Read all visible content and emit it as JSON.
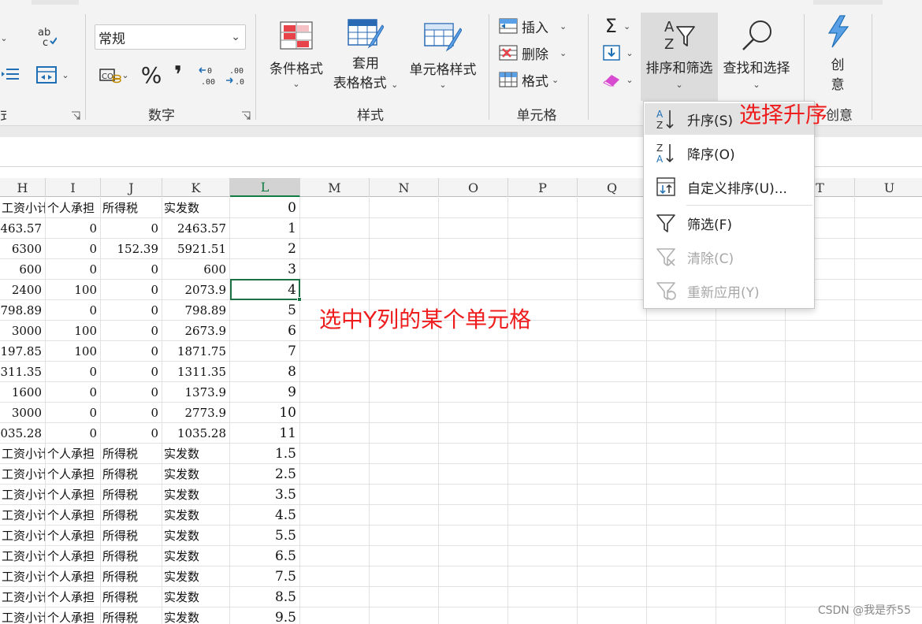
{
  "ribbon": {
    "number_format_value": "常规",
    "groups": {
      "number": "数字",
      "styles": "样式",
      "cells": "单元格",
      "creative": "创意"
    },
    "group_partial_left": "式",
    "percent_symbol": "%",
    "comma_symbol": "❜",
    "buttons": {
      "conditional_format": "条件格式",
      "table_format_line1": "套用",
      "table_format_line2": "表格格式",
      "cell_styles": "单元格样式",
      "insert": "插入",
      "delete": "删除",
      "format": "格式",
      "sort_filter": "排序和筛选",
      "find_select": "查找和选择",
      "creative_line1": "创",
      "creative_line2": "意"
    }
  },
  "grid": {
    "columns": [
      "H",
      "I",
      "J",
      "K",
      "L",
      "M",
      "N",
      "O",
      "P",
      "Q",
      "R",
      "S",
      "T",
      "U"
    ],
    "active_column": "L",
    "visible_dropdown_covered_columns": [
      "T",
      "U"
    ],
    "rows": [
      {
        "h": "工资小计",
        "i": "个人承担",
        "j": "所得税",
        "k": "实发数",
        "l": "0"
      },
      {
        "h": "463.57",
        "i": "0",
        "j": "0",
        "k": "2463.57",
        "l": "1"
      },
      {
        "h": "6300",
        "i": "0",
        "j": "152.39",
        "k": "5921.51",
        "l": "2"
      },
      {
        "h": "600",
        "i": "0",
        "j": "0",
        "k": "600",
        "l": "3"
      },
      {
        "h": "2400",
        "i": "100",
        "j": "0",
        "k": "2073.9",
        "l": "4"
      },
      {
        "h": "798.89",
        "i": "0",
        "j": "0",
        "k": "798.89",
        "l": "5"
      },
      {
        "h": "3000",
        "i": "100",
        "j": "0",
        "k": "2673.9",
        "l": "6"
      },
      {
        "h": "197.85",
        "i": "100",
        "j": "0",
        "k": "1871.75",
        "l": "7"
      },
      {
        "h": "311.35",
        "i": "0",
        "j": "0",
        "k": "1311.35",
        "l": "8"
      },
      {
        "h": "1600",
        "i": "0",
        "j": "0",
        "k": "1373.9",
        "l": "9"
      },
      {
        "h": "3000",
        "i": "0",
        "j": "0",
        "k": "2773.9",
        "l": "10"
      },
      {
        "h": "035.28",
        "i": "0",
        "j": "0",
        "k": "1035.28",
        "l": "11"
      },
      {
        "h": "工资小计",
        "i": "个人承担",
        "j": "所得税",
        "k": "实发数",
        "l": "1.5"
      },
      {
        "h": "工资小计",
        "i": "个人承担",
        "j": "所得税",
        "k": "实发数",
        "l": "2.5"
      },
      {
        "h": "工资小计",
        "i": "个人承担",
        "j": "所得税",
        "k": "实发数",
        "l": "3.5"
      },
      {
        "h": "工资小计",
        "i": "个人承担",
        "j": "所得税",
        "k": "实发数",
        "l": "4.5"
      },
      {
        "h": "工资小计",
        "i": "个人承担",
        "j": "所得税",
        "k": "实发数",
        "l": "5.5"
      },
      {
        "h": "工资小计",
        "i": "个人承担",
        "j": "所得税",
        "k": "实发数",
        "l": "6.5"
      },
      {
        "h": "工资小计",
        "i": "个人承担",
        "j": "所得税",
        "k": "实发数",
        "l": "7.5"
      },
      {
        "h": "工资小计",
        "i": "个人承担",
        "j": "所得税",
        "k": "实发数",
        "l": "8.5"
      },
      {
        "h": "工资小计",
        "i": "个人承担",
        "j": "所得税",
        "k": "实发数",
        "l": "9.5"
      }
    ],
    "selected_cell": "L5"
  },
  "dropdown": {
    "items": [
      {
        "label": "升序(S)",
        "icon": "sort-ascending-icon",
        "state": "hover"
      },
      {
        "label": "降序(O)",
        "icon": "sort-descending-icon",
        "state": "normal"
      },
      {
        "label": "自定义排序(U)...",
        "icon": "custom-sort-icon",
        "state": "normal"
      },
      {
        "label": "筛选(F)",
        "icon": "filter-icon",
        "state": "normal"
      },
      {
        "label": "清除(C)",
        "icon": "clear-filter-icon",
        "state": "disabled"
      },
      {
        "label": "重新应用(Y)",
        "icon": "reapply-filter-icon",
        "state": "disabled"
      }
    ]
  },
  "annotations": {
    "select_ascending": "选择升序",
    "select_cell": "选中Y列的某个单元格",
    "color": "#ee1c1c"
  },
  "watermark": "CSDN @我是乔55",
  "colors": {
    "excel_green": "#1e7145",
    "ribbon_bg": "#f3f3f3",
    "hover_bg": "#dcdcdc"
  }
}
